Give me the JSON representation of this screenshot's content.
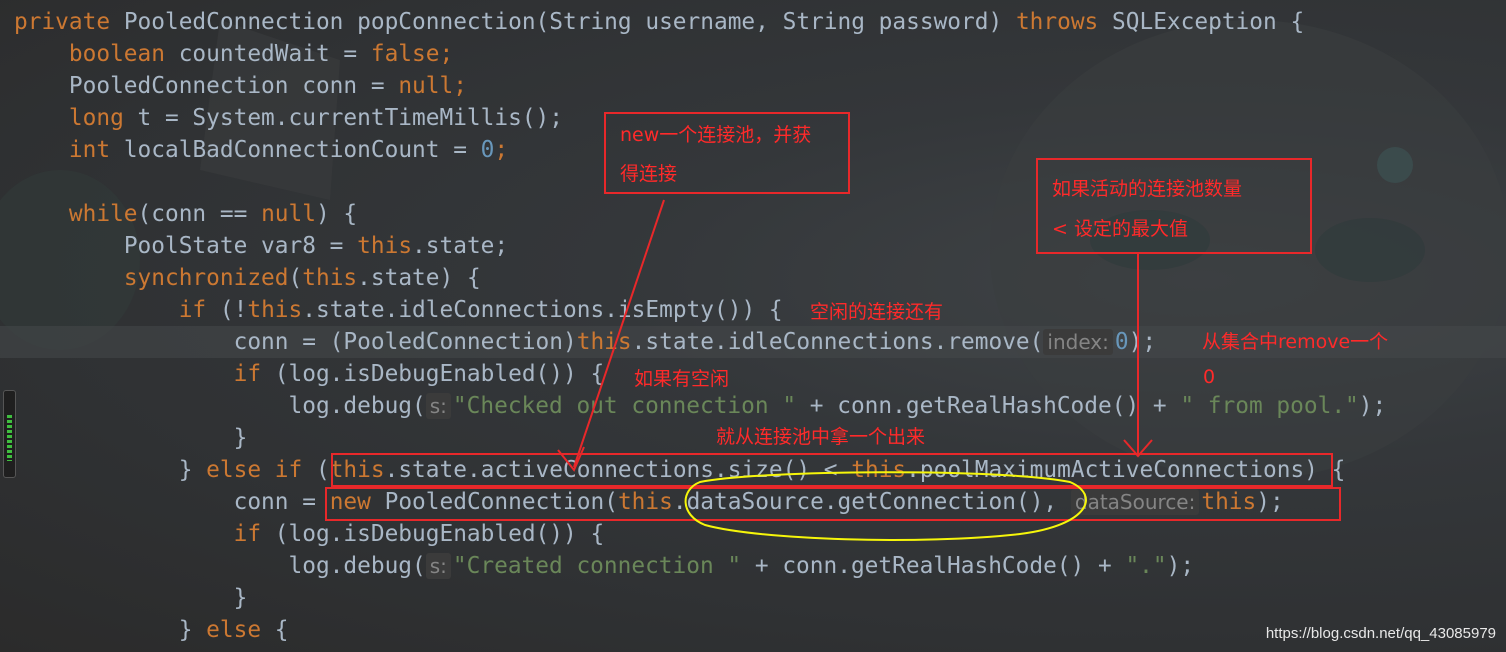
{
  "code": {
    "l1": {
      "kw1": "private ",
      "sig": "PooledConnection popConnection(String username, String password) ",
      "kw2": "throws",
      "tail": " SQLException {"
    },
    "l2": {
      "kw": "boolean",
      "mid": " countedWait = ",
      "kw2": "false",
      "tail": ";"
    },
    "l3": {
      "mid": "PooledConnection conn = ",
      "kw": "null",
      "tail": ";"
    },
    "l4": {
      "kw": "long",
      "mid": " t = System.currentTimeMillis();"
    },
    "l5": {
      "kw": "int",
      "mid": " localBadConnectionCount = ",
      "num": "0",
      "tail": ";"
    },
    "l6": {
      "kw": "while",
      "mid": "(conn == ",
      "kw2": "null",
      "tail": ") {"
    },
    "l7": {
      "mid": "PoolState var8 = ",
      "kw": "this",
      "tail": ".state;"
    },
    "l8": {
      "kw": "synchronized",
      "mid": "(",
      "kw2": "this",
      "tail": ".state) {"
    },
    "l9": {
      "kw": "if",
      "mid": " (!",
      "kw2": "this",
      "tail": ".state.idleConnections.isEmpty()) {"
    },
    "l10": {
      "pre": "conn = (PooledConnection)",
      "kw": "this",
      "mid": ".state.idleConnections.remove(",
      "hint": "index:",
      "num": "0",
      "tail": ");"
    },
    "l11": {
      "kw": "if",
      "tail": " (log.isDebugEnabled()) {"
    },
    "l12": {
      "pre": "log.debug(",
      "hint": "s:",
      "str": "\"Checked out connection \"",
      "mid": " + conn.getRealHashCode() + ",
      "str2": "\" from pool.\"",
      "tail": ");"
    },
    "l13": {
      "tail": "}"
    },
    "l14": {
      "pre": "} ",
      "kw": "else if",
      "mid": " (",
      "kw2": "this",
      "mid2": ".state.activeConnections.size() < ",
      "kw3": "this",
      "tail": ".poolMaximumActiveConnections) {"
    },
    "l15": {
      "pre": "conn = ",
      "kw": "new",
      "mid": " PooledConnection(",
      "kw2": "this",
      "mid2": ".dataSource.getConnection(), ",
      "hint": "dataSource:",
      "kw3": "this",
      "tail": ");"
    },
    "l16": {
      "kw": "if",
      "tail": " (log.isDebugEnabled()) {"
    },
    "l17": {
      "pre": "log.debug(",
      "hint": "s:",
      "str": "\"Created connection \"",
      "mid": " + conn.getRealHashCode() + ",
      "str2": "\".\"",
      "tail": ");"
    },
    "l18": {
      "tail": "}"
    },
    "l19": {
      "pre": "} ",
      "kw": "else",
      "tail": " {"
    }
  },
  "annotations": {
    "new_pool_line1": "new一个连接池，并获",
    "new_pool_line2": "得连接",
    "active_line1": "如果活动的连接池数量",
    "active_line2": "< 设定的最大值",
    "idle_remaining": "空闲的连接还有",
    "remove_line1": "从集合中remove一个",
    "remove_line2": "0",
    "if_idle": "如果有空闲",
    "take_one": "就从连接池中拿一个出来"
  },
  "watermark": "https://blog.csdn.net/qq_43085979",
  "colors": {
    "keyword": "#cc7832",
    "string": "#6a8759",
    "number": "#6897bb",
    "text": "#a9b7c6",
    "annotation": "#ff2a2a"
  }
}
